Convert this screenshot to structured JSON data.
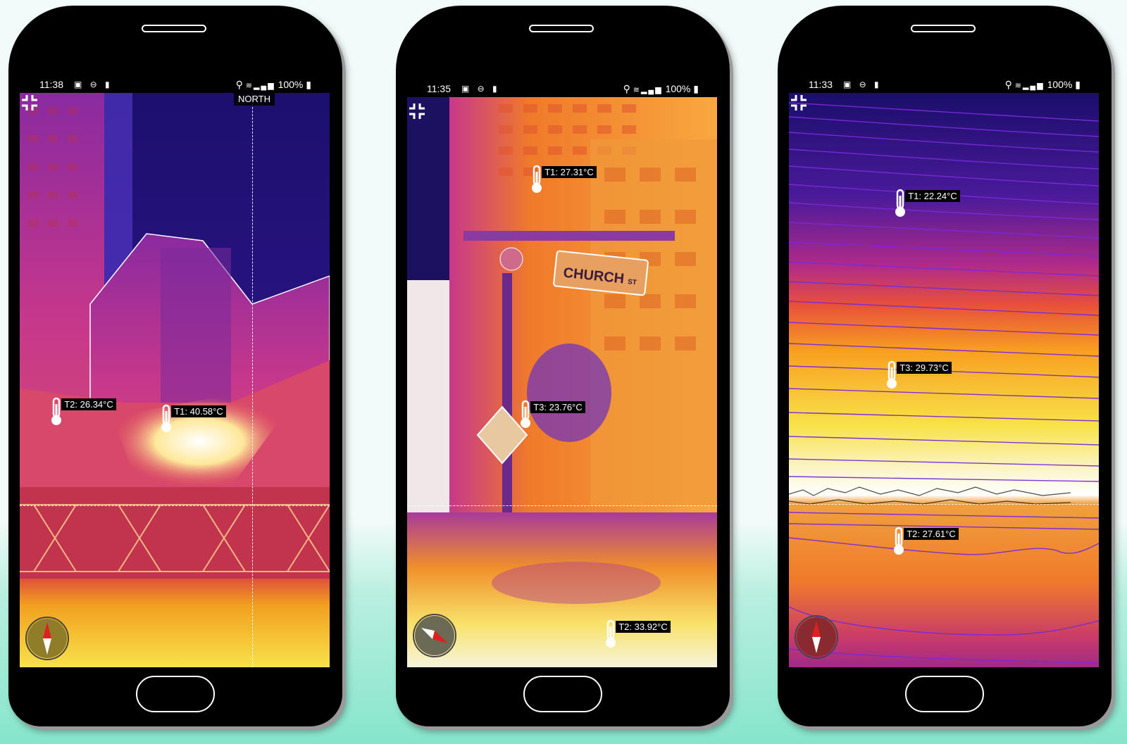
{
  "phones": [
    {
      "time": "11:38",
      "status_icons": "▣ ⊖ ▮",
      "battery": "100%",
      "north_label": "NORTH",
      "probes": [
        {
          "label": "T2: 26.34°C"
        },
        {
          "label": "T1: 40.58°C"
        }
      ],
      "compass_color": "#8f7d2a"
    },
    {
      "time": "11:35",
      "status_icons": "▣ ⊖ ▮",
      "battery": "100%",
      "sign_text": "CHURCH",
      "sign_suffix": "ST",
      "probes": [
        {
          "label": "T1: 27.31°C"
        },
        {
          "label": "T3: 23.76°C"
        },
        {
          "label": "T2: 33.92°C"
        }
      ],
      "compass_color": "#6b6b55"
    },
    {
      "time": "11:33",
      "status_icons": "▣ ⊖ ▮",
      "battery": "100%",
      "probes": [
        {
          "label": "T1: 22.24°C"
        },
        {
          "label": "T3: 29.73°C"
        },
        {
          "label": "T2: 27.61°C"
        }
      ],
      "compass_color": "#8a2a2f"
    }
  ],
  "icons": {
    "collapse": "collapse-icon",
    "thermometer": "thermometer-icon",
    "compass": "compass-icon",
    "location": "location-icon",
    "wifi": "wifi-icon",
    "signal": "signal-icon",
    "battery": "battery-icon"
  },
  "colors": {
    "background_top": "#f2fbfa",
    "background_bottom": "#86e5cc",
    "phone_body": "#000000",
    "label_bg": "#000000",
    "label_text": "#ffffff"
  }
}
